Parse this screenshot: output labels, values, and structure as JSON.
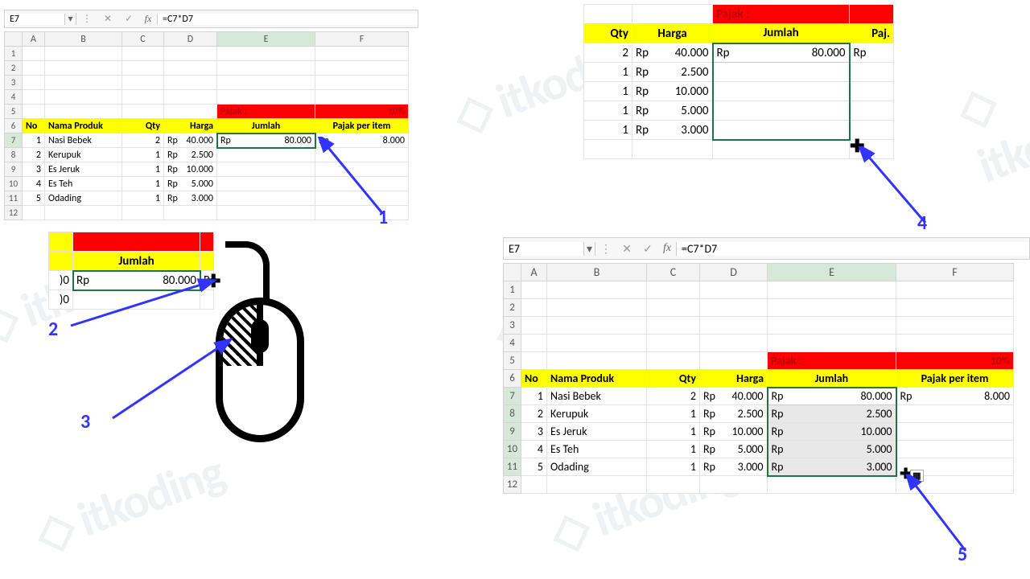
{
  "watermark": "itkoding",
  "callouts": [
    "1",
    "2",
    "3",
    "4",
    "5"
  ],
  "formula_bar": {
    "cell": "E7",
    "formula": "=C7*D7",
    "fx": "fx",
    "cancel": "✕",
    "accept": "✓",
    "dd": "▾",
    "sep": "⋮"
  },
  "columns": [
    "A",
    "B",
    "C",
    "D",
    "E",
    "F"
  ],
  "headers": {
    "no": "No",
    "nama": "Nama Produk",
    "qty": "Qty",
    "harga": "Harga",
    "jumlah": "Jumlah",
    "pajak_item": "Pajak per item",
    "pajak_label": "Pajak :",
    "pajak_pct": "10%"
  },
  "rows": [
    {
      "no": "1",
      "nama": "Nasi Bebek",
      "qty": "2",
      "harga": "40.000",
      "jumlah": "80.000",
      "pajak": "8.000"
    },
    {
      "no": "2",
      "nama": "Kerupuk",
      "qty": "1",
      "harga": "2.500",
      "jumlah": "2.500",
      "pajak": ""
    },
    {
      "no": "3",
      "nama": "Es Jeruk",
      "qty": "1",
      "harga": "10.000",
      "jumlah": "10.000",
      "pajak": ""
    },
    {
      "no": "4",
      "nama": "Es Teh",
      "qty": "1",
      "harga": "5.000",
      "jumlah": "5.000",
      "pajak": ""
    },
    {
      "no": "5",
      "nama": "Odading",
      "qty": "1",
      "harga": "3.000",
      "jumlah": "3.000",
      "pajak": ""
    }
  ],
  "cur": "Rp",
  "zoom_p2": {
    "label": "Jumlah",
    "val": "80.000",
    "partial1": ")0",
    "partial2": ")0",
    "rp_next": "R"
  },
  "zoom_p4": {
    "qty": "Qty",
    "harga": "Harga",
    "jumlah": "Jumlah",
    "paj": "Paj.",
    "pajak_label": "Pajak :"
  }
}
